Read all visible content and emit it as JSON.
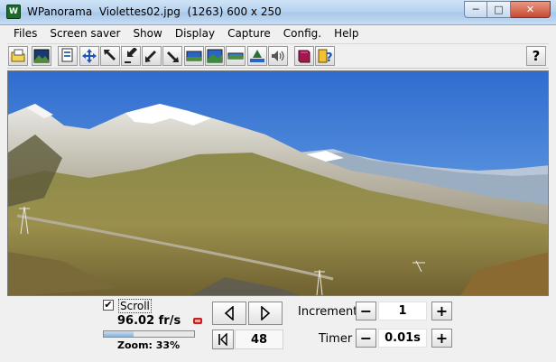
{
  "window": {
    "title": "WPanorama  Violettes02.jpg  (1263) 600 x 250",
    "app_icon_glyph": "W",
    "minimize_glyph": "─",
    "maximize_glyph": "□",
    "close_glyph": "✕"
  },
  "menu": [
    "Files",
    "Screen saver",
    "Show",
    "Display",
    "Capture",
    "Config.",
    "Help"
  ],
  "toolbar": {
    "icons": [
      "open-file-icon",
      "image-icon",
      "copy-icon",
      "move-arrows-icon",
      "arrow-up-left-icon",
      "arrow-in-icon",
      "arrow-down-left-icon",
      "arrow-down-right-icon",
      "panorama-view-icon",
      "panorama-fit-icon",
      "panorama-strip-icon",
      "horizon-icon",
      "speaker-icon",
      "book-icon",
      "help-book-icon"
    ],
    "help_glyph": "?"
  },
  "controls": {
    "scroll_checked": true,
    "scroll_check_glyph": "✔",
    "scroll_label": "Scroll",
    "fps": "96.02 fr/s",
    "zoom_label": "Zoom: 33%",
    "zoom_percent": 33,
    "step_value": "48",
    "increment_label": "Increment",
    "increment_value": "1",
    "timer_label": "Timer",
    "timer_value": "0.01s",
    "minus_glyph": "−",
    "plus_glyph": "+"
  },
  "colors": {
    "sky_top": "#2f6ccf",
    "sky_horizon": "#a9c8ea",
    "grass": "#8a8a3a",
    "zoom_fill": "#8db3da"
  }
}
